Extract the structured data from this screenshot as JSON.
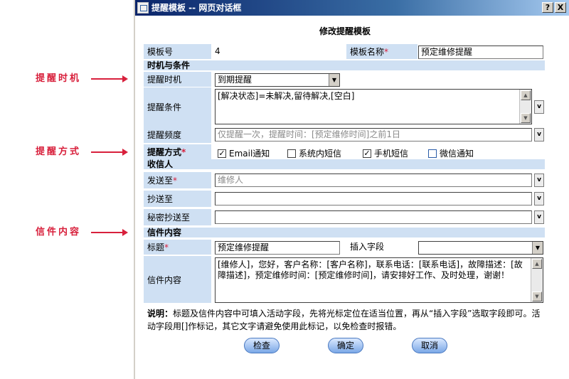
{
  "annotations": [
    {
      "label": "提醒时机"
    },
    {
      "label": "提醒方式"
    },
    {
      "label": "信件内容"
    }
  ],
  "window": {
    "title": "提醒模板 -- 网页对话框",
    "help_label": "?",
    "close_label": "X"
  },
  "form": {
    "title": "修改提醒模板",
    "template_no_label": "模板号",
    "template_no_value": "4",
    "template_name_label": "模板名称",
    "template_name_value": "预定维修提醒",
    "section_timing": "时机与条件",
    "timing_label": "提醒时机",
    "timing_value": "到期提醒",
    "condition_label": "提醒条件",
    "condition_value": "[解决状态]=未解决,留待解决,[空白]",
    "frequency_label": "提醒频度",
    "frequency_value": "仅提醒一次，提醒时间：[预定维修时间]之前1日",
    "method_label": "提醒方式",
    "methods": [
      {
        "label": "Email通知",
        "checked": true
      },
      {
        "label": "系统内短信",
        "checked": false
      },
      {
        "label": "手机短信",
        "checked": true
      },
      {
        "label": "微信通知",
        "checked": false
      }
    ],
    "section_recipients": "收信人",
    "send_to_label": "发送至",
    "send_to_value": "维修人",
    "cc_label": "抄送至",
    "cc_value": "",
    "bcc_label": "秘密抄送至",
    "bcc_value": "",
    "section_letter": "信件内容",
    "subject_label": "标题",
    "subject_value": "预定维修提醒",
    "insert_field_label": "插入字段",
    "insert_field_value": "",
    "content_label": "信件内容",
    "content_value": "[维修人]，您好，客户名称：[客户名称]，联系电话：[联系电话]，故障描述：[故障描述]，预定维修时间：[预定维修时间]，请安排好工作、及时处理，谢谢！",
    "dropdown_label": "v",
    "note_label": "说明：",
    "note_text": "标题及信件内容中可填入活动字段，先将光标定位在适当位置，再从“插入字段”选取字段即可。活动字段用[]作标记，其它文字请避免使用此标记，以免检查时报错。",
    "buttons": {
      "check": "检查",
      "ok": "确定",
      "cancel": "取消"
    }
  }
}
